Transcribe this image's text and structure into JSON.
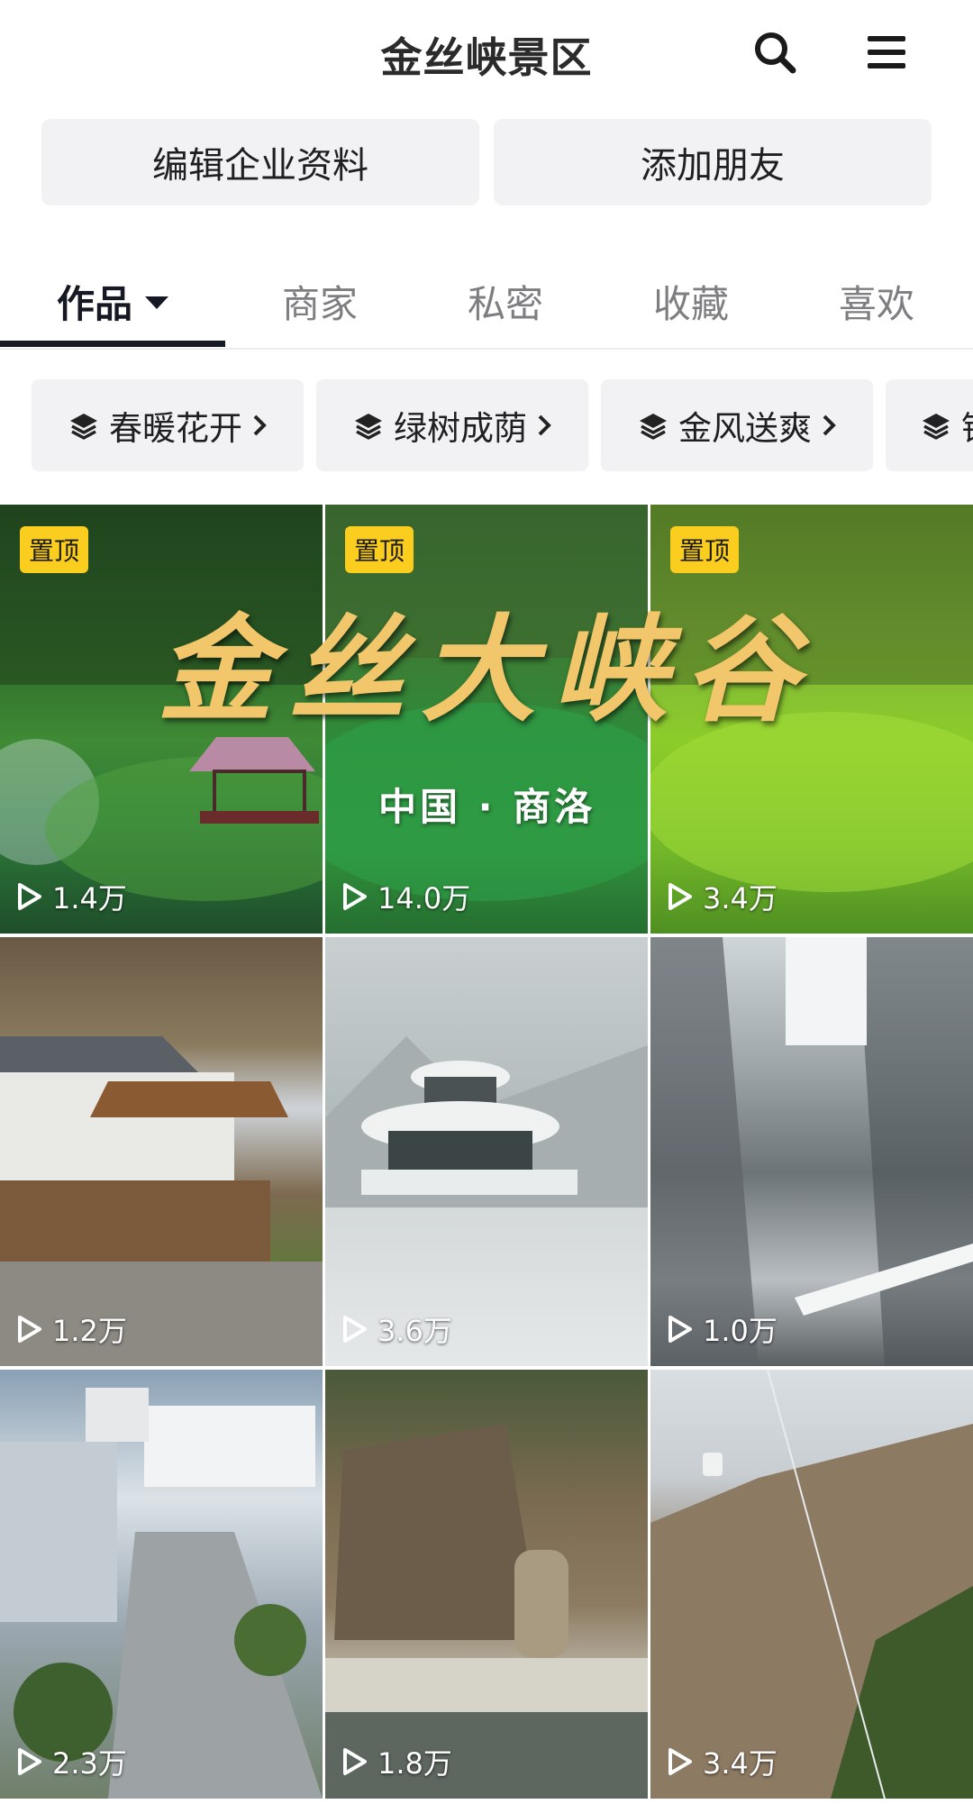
{
  "header": {
    "title": "金丝峡景区",
    "search_icon": "search-icon",
    "menu_icon": "menu-icon"
  },
  "actions": {
    "edit_profile": "编辑企业资料",
    "add_friend": "添加朋友"
  },
  "tabs": [
    {
      "label": "作品",
      "active": true
    },
    {
      "label": "商家"
    },
    {
      "label": "私密"
    },
    {
      "label": "收藏"
    },
    {
      "label": "喜欢"
    }
  ],
  "collections": [
    {
      "label": "春暖花开"
    },
    {
      "label": "绿树成荫"
    },
    {
      "label": "金风送爽"
    },
    {
      "label": "银"
    }
  ],
  "videos": [
    {
      "views": "1.4万",
      "pinned": true,
      "pin_label": "置顶"
    },
    {
      "views": "14.0万",
      "pinned": true,
      "pin_label": "置顶"
    },
    {
      "views": "3.4万",
      "pinned": true,
      "pin_label": "置顶"
    },
    {
      "views": "1.2万"
    },
    {
      "views": "3.6万"
    },
    {
      "views": "1.0万"
    },
    {
      "views": "2.3万"
    },
    {
      "views": "1.8万"
    },
    {
      "views": "3.4万"
    }
  ],
  "banner": {
    "calligraphy": "金丝大峡谷",
    "subtitle": "中国 · 商洛"
  },
  "colors": {
    "pin_badge": "#facd1e",
    "chip_bg": "#f2f2f4",
    "tab_active": "#161823"
  }
}
